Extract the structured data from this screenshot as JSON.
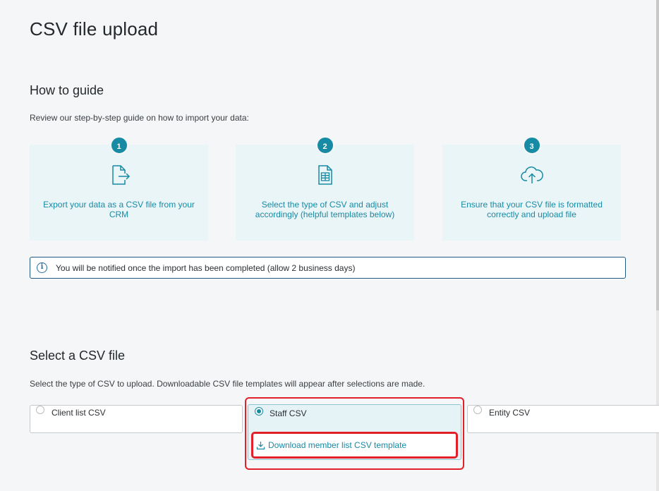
{
  "page": {
    "title": "CSV file upload"
  },
  "guide": {
    "title": "How to guide",
    "description": "Review our step-by-step guide on how to import your data:",
    "steps": [
      {
        "number": "1",
        "icon": "file-export-icon",
        "text": "Export your data as a CSV file from your CRM"
      },
      {
        "number": "2",
        "icon": "spreadsheet-icon",
        "text": "Select the type of CSV and adjust accordingly (helpful templates below)"
      },
      {
        "number": "3",
        "icon": "cloud-upload-icon",
        "text": "Ensure that your CSV file is formatted correctly and upload file"
      }
    ],
    "info": "You will be notified once the import has been completed (allow 2 business days)"
  },
  "select": {
    "title": "Select a CSV file",
    "description": "Select the type of CSV to upload. Downloadable CSV file templates will appear after selections are made.",
    "options": [
      {
        "label": "Client list CSV",
        "selected": false
      },
      {
        "label": "Staff CSV",
        "selected": true
      },
      {
        "label": "Entity CSV",
        "selected": false
      }
    ],
    "download_link": "Download member list CSV template"
  },
  "colors": {
    "accent": "#178aa4",
    "highlight": "#e2202a",
    "info_border": "#1e5a85"
  }
}
